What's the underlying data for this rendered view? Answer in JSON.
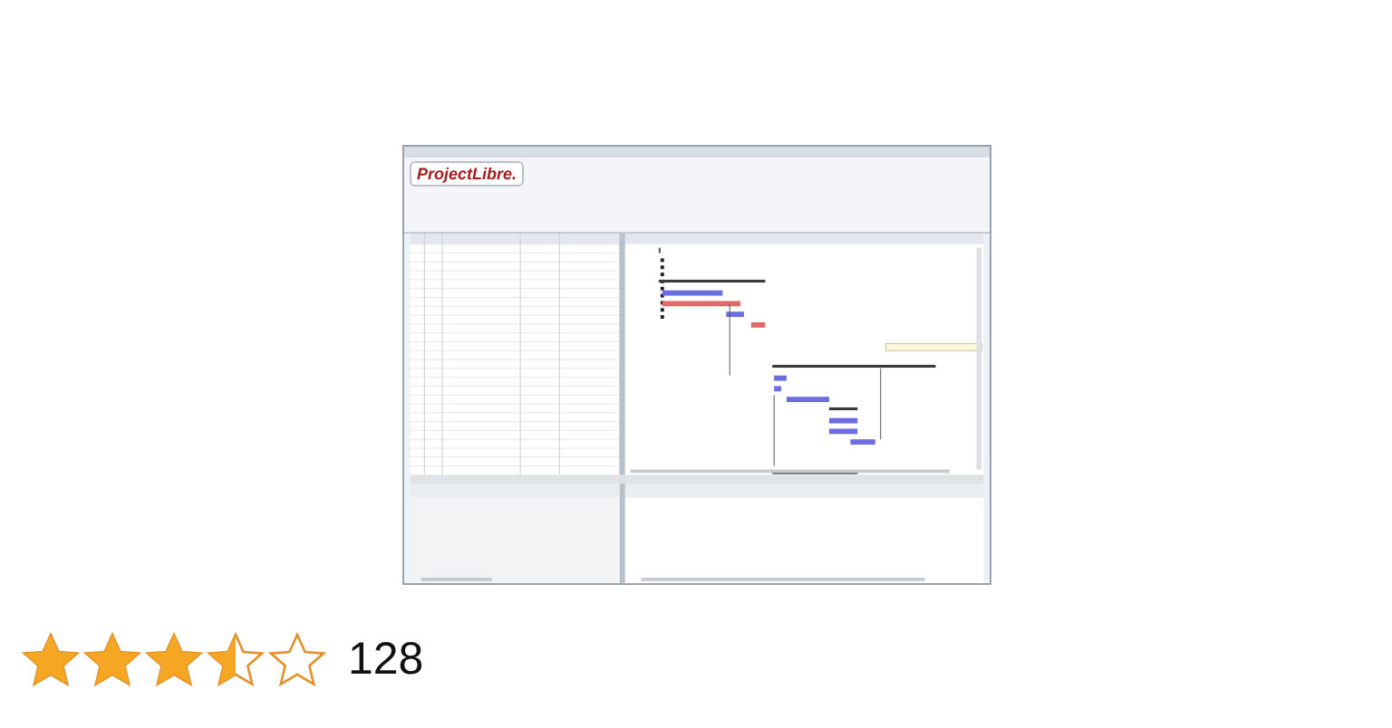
{
  "product_image": {
    "logo": "ProjectLibre."
  },
  "rating": {
    "stars": 3.5,
    "count": "128"
  }
}
